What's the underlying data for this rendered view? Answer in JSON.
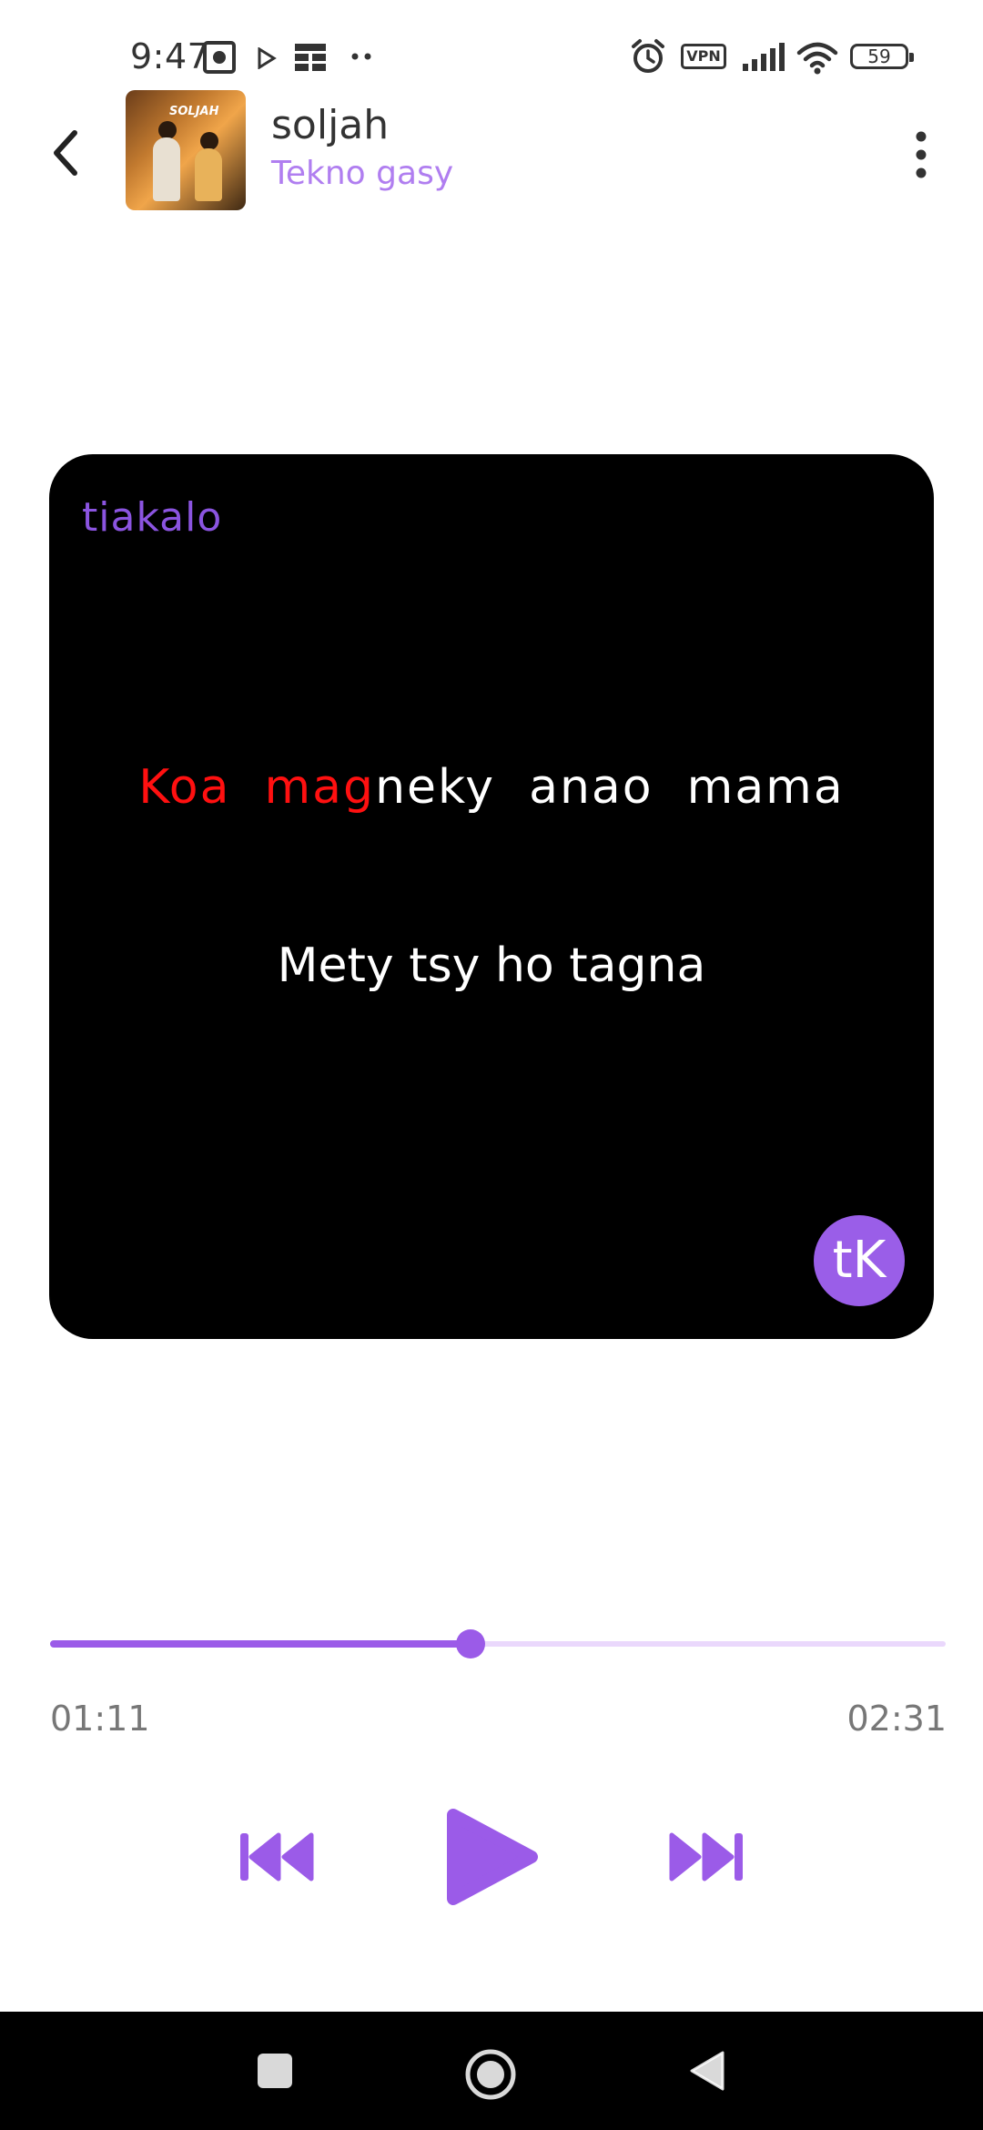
{
  "status_bar": {
    "time": "9:47",
    "vpn_label": "VPN",
    "battery_level": "59"
  },
  "header": {
    "song_title": "soljah",
    "artist": "Tekno gasy",
    "cover_caption": "SOLJAH"
  },
  "lyrics": {
    "brand": "tiakalo",
    "current_line_sung": "Koa  mag",
    "current_line_rest": "neky  anao  mama",
    "next_line": "Mety tsy ho tagna",
    "logo_text": "tK"
  },
  "player": {
    "elapsed": "01:11",
    "total": "02:31",
    "progress": 0.47
  },
  "colors": {
    "accent": "#9b5be8",
    "artist": "#b07ef0",
    "lyric_highlight": "#ff1010",
    "card_background": "#000000"
  },
  "icons": {
    "back": "chevron-left-icon",
    "more": "more-vertical-icon",
    "prev": "skip-previous-icon",
    "play": "play-icon",
    "next": "skip-next-icon"
  }
}
